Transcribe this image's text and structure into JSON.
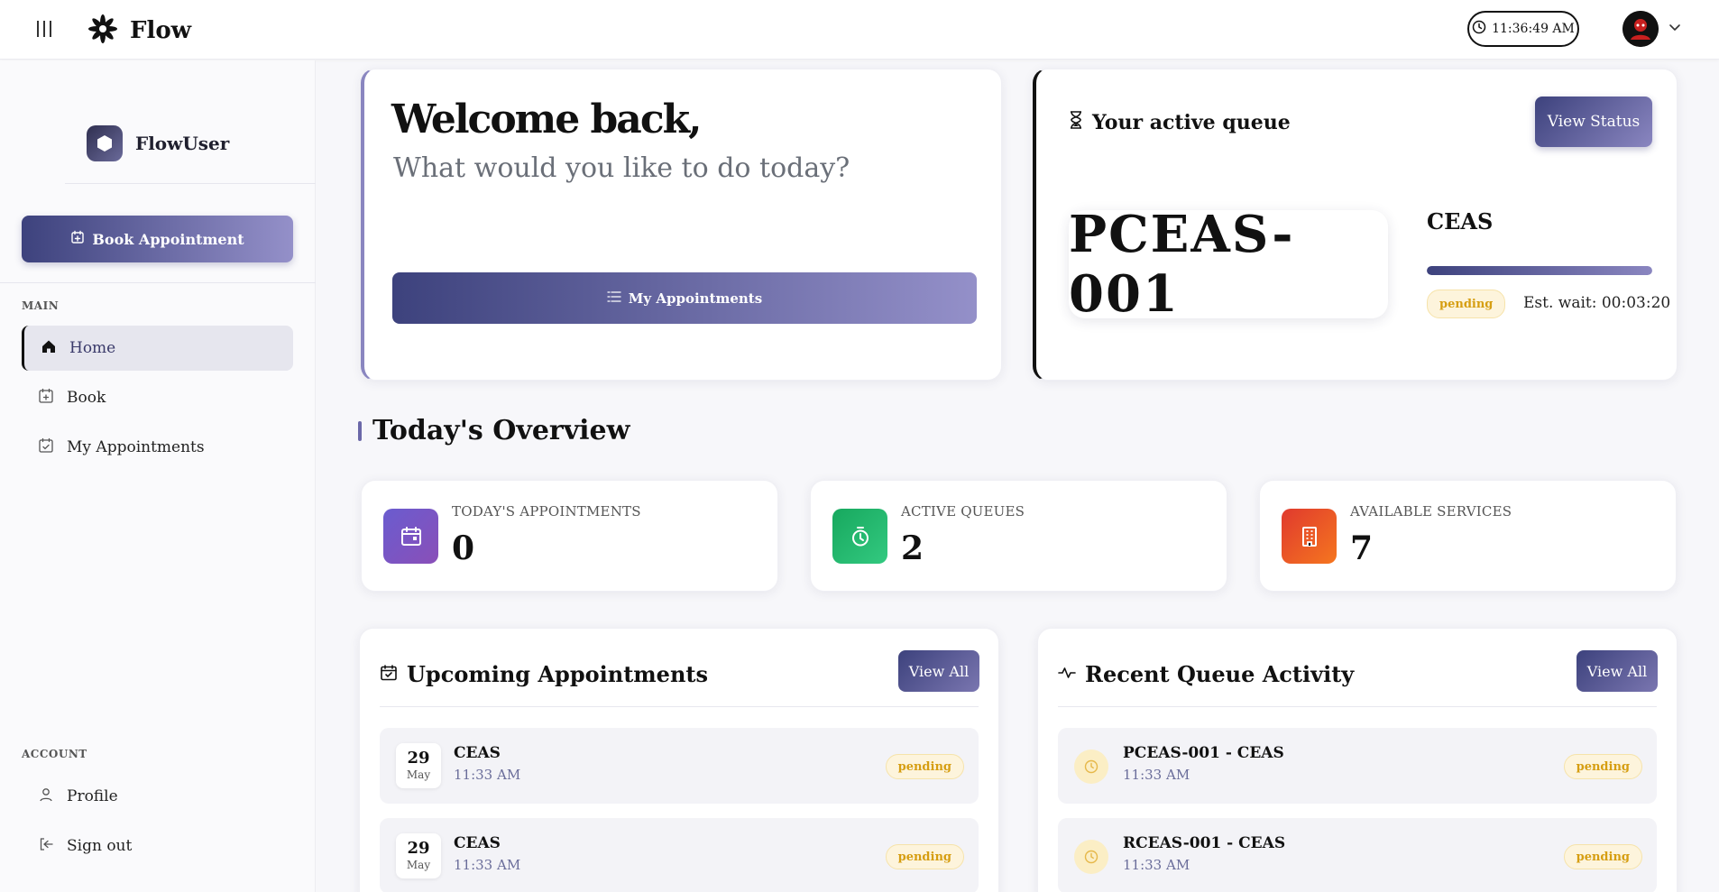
{
  "header": {
    "brand": "Flow",
    "time": "11:36:49 AM"
  },
  "sidebar": {
    "user_name": "FlowUser",
    "book_button": "Book Appointment",
    "main_section": "MAIN",
    "account_section": "ACCOUNT",
    "main_items": [
      {
        "label": "Home",
        "icon": "home-icon",
        "active": true
      },
      {
        "label": "Book",
        "icon": "calendar-plus-icon",
        "active": false
      },
      {
        "label": "My Appointments",
        "icon": "calendar-check-icon",
        "active": false
      }
    ],
    "account_items": [
      {
        "label": "Profile",
        "icon": "user-icon"
      },
      {
        "label": "Sign out",
        "icon": "sign-out-icon"
      }
    ]
  },
  "welcome": {
    "title": "Welcome back,",
    "subtitle": "What would you like to do today?",
    "button": "My Appointments"
  },
  "queue": {
    "title": "Your active queue",
    "button": "View Status",
    "ticket": "PCEAS-001",
    "service": "CEAS",
    "status": "pending",
    "est_wait": "Est. wait: 00:03:20",
    "progress": 1.0
  },
  "overview": {
    "title": "Today's Overview",
    "stats": [
      {
        "label": "TODAY'S APPOINTMENTS",
        "value": "0",
        "icon": "calendar-icon",
        "color": "#7a57c9"
      },
      {
        "label": "ACTIVE QUEUES",
        "value": "2",
        "icon": "timer-icon",
        "color": "#22b26a"
      },
      {
        "label": "AVAILABLE SERVICES",
        "value": "7",
        "icon": "building-icon",
        "color": "#ea4f2a"
      }
    ]
  },
  "upcoming": {
    "title": "Upcoming Appointments",
    "view_all": "View All",
    "items": [
      {
        "day": "29",
        "month": "May",
        "service": "CEAS",
        "time": "11:33 AM",
        "status": "pending"
      },
      {
        "day": "29",
        "month": "May",
        "service": "CEAS",
        "time": "11:33 AM",
        "status": "pending"
      }
    ]
  },
  "recent": {
    "title": "Recent Queue Activity",
    "view_all": "View All",
    "items": [
      {
        "title": "PCEAS-001 - CEAS",
        "time": "11:33 AM",
        "status": "pending"
      },
      {
        "title": "RCEAS-001 - CEAS",
        "time": "11:33 AM",
        "status": "pending"
      }
    ]
  },
  "colors": {
    "accent_start": "#3d427d",
    "accent_end": "#9490c9",
    "pending": "#d69e12"
  }
}
